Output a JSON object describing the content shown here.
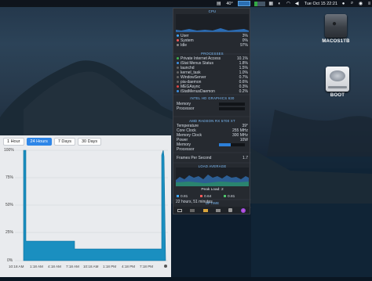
{
  "menubar": {
    "temp": "40°",
    "clock": "Tue Oct 15  22:21"
  },
  "desktop": {
    "icons": [
      {
        "label": "MACOS1TB"
      },
      {
        "label": "BOOT"
      }
    ]
  },
  "history": {
    "tabs": [
      "1 Hour",
      "24 Hours",
      "7 Days",
      "30 Days"
    ],
    "active_tab": "24 Hours",
    "y_ticks": [
      "100%",
      "75%",
      "50%",
      "25%",
      "0%"
    ],
    "x_ticks": [
      "10:18 AM",
      "1:18 AM",
      "4:18 AM",
      "7:18 AM",
      "10:18 AM",
      "1:18 PM",
      "4:18 PM",
      "7:18 PM"
    ]
  },
  "panel": {
    "cpu": {
      "title": "CPU",
      "rows": [
        {
          "label": "User",
          "value": "3%",
          "color": "#3fa7ff"
        },
        {
          "label": "System",
          "value": "0%",
          "color": "#ff5a5a"
        },
        {
          "label": "Idle",
          "value": "97%",
          "color": "#888888"
        }
      ]
    },
    "processes": {
      "title": "PROCESSES",
      "rows": [
        {
          "label": "Private Internet Access",
          "value": "10.1%"
        },
        {
          "label": "iStat Menus Status",
          "value": "1.8%"
        },
        {
          "label": "launchd",
          "value": "1.5%"
        },
        {
          "label": "kernel_task",
          "value": "1.0%"
        },
        {
          "label": "WindowServer",
          "value": "0.7%"
        },
        {
          "label": "pia-daemon",
          "value": "0.6%"
        },
        {
          "label": "MEGAsync",
          "value": "0.3%"
        },
        {
          "label": "iStatMenusDaemon",
          "value": "0.2%"
        }
      ]
    },
    "intel_gpu": {
      "title": "INTEL HD GRAPHICS 630",
      "rows": [
        {
          "label": "Memory"
        },
        {
          "label": "Processor"
        }
      ]
    },
    "amd_gpu": {
      "title": "AMD RADEON RX 5700 XT",
      "rows": [
        {
          "label": "Temperature",
          "value": "39°"
        },
        {
          "label": "Core Clock",
          "value": "255 MHz"
        },
        {
          "label": "Memory Clock",
          "value": "300 MHz"
        },
        {
          "label": "Power",
          "value": "10W"
        },
        {
          "label": "Memory",
          "bar_fraction": 0.45
        },
        {
          "label": "Processor"
        }
      ]
    },
    "fps": {
      "label": "Frames Per Second",
      "value": "1.7"
    },
    "load": {
      "title": "LOAD AVERAGE",
      "peak": "Peak Load: 2",
      "legend": [
        {
          "value": "0.81",
          "color": "#3fa7ff"
        },
        {
          "value": "0.64",
          "color": "#ff5a5a"
        },
        {
          "value": "0.81",
          "color": "#4ec46a"
        }
      ]
    },
    "uptime": {
      "title": "UPTIME",
      "value": "22 hours, 51 minutes"
    }
  }
}
